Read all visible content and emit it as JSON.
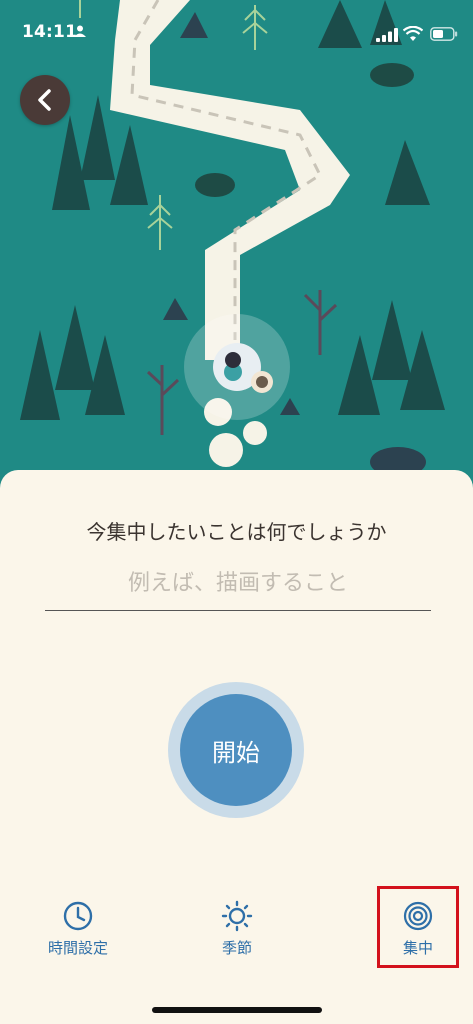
{
  "status_bar": {
    "time": "14:11",
    "icons": [
      "person-icon",
      "cellular-signal-icon",
      "wifi-icon",
      "battery-icon"
    ]
  },
  "navigation": {
    "back_icon": "chevron-left-icon"
  },
  "focus_panel": {
    "question": "今集中したいことは何でしょうか",
    "task_placeholder": "例えば、描画すること",
    "task_value": "",
    "start_label": "開始"
  },
  "bottom_nav": {
    "items": [
      {
        "label": "時間設定",
        "icon": "clock-icon"
      },
      {
        "label": "季節",
        "icon": "sun-icon"
      },
      {
        "label": "集中",
        "icon": "target-icon",
        "selected": true
      }
    ]
  },
  "colors": {
    "scene_teal": "#1f8a85",
    "sheet_bg": "#fbf6ea",
    "accent_blue": "#2e6fa8",
    "start_button": "#4e8fc0",
    "highlight_red": "#d3121c"
  }
}
